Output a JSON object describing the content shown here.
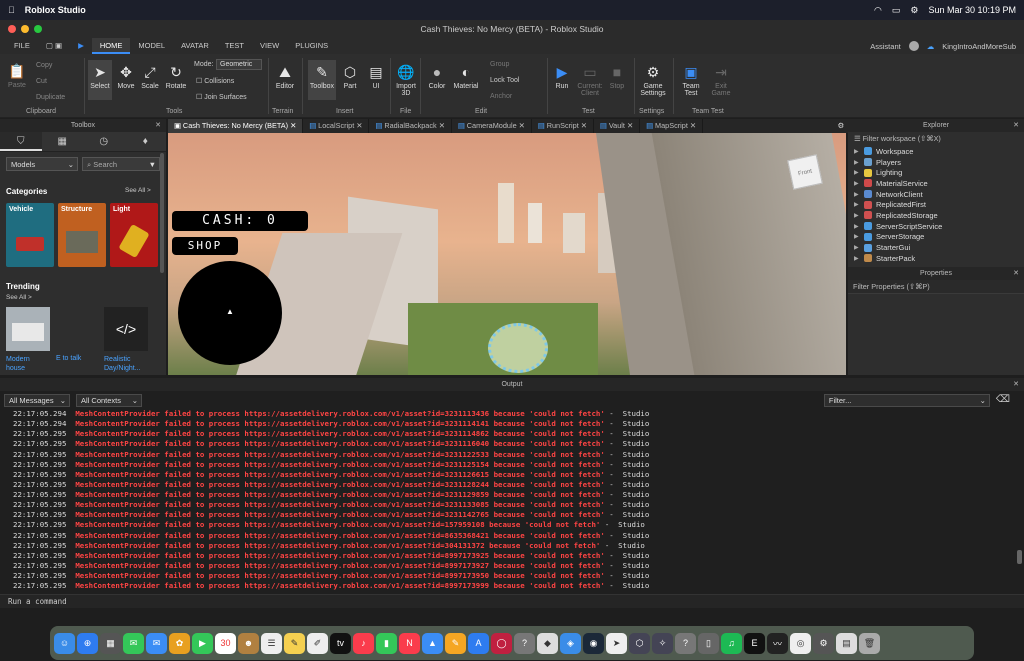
{
  "menubar": {
    "app": "Roblox Studio",
    "datetime": "Sun Mar 30  10:19 PM"
  },
  "window": {
    "title": "Cash Thieves: No Mercy (BETA) - Roblox Studio"
  },
  "tabs": [
    {
      "label": "FILE"
    },
    {
      "label": "HOME"
    },
    {
      "label": "MODEL"
    },
    {
      "label": "AVATAR"
    },
    {
      "label": "TEST"
    },
    {
      "label": "VIEW"
    },
    {
      "label": "PLUGINS"
    }
  ],
  "header": {
    "assistant": "Assistant",
    "username": "KingIntroAndMoreSub"
  },
  "ribbon": {
    "clipboard": {
      "paste": "Paste",
      "copy": "Copy",
      "cut": "Cut",
      "duplicate": "Duplicate",
      "group": "Clipboard"
    },
    "tools": {
      "select": "Select",
      "move": "Move",
      "scale": "Scale",
      "rotate": "Rotate",
      "mode_label": "Mode:",
      "mode_value": "Geometric",
      "collisions": "Collisions",
      "join": "Join Surfaces",
      "group": "Tools"
    },
    "terrain": {
      "editor": "Editor",
      "group": "Terrain"
    },
    "insert": {
      "toolbox": "Toolbox",
      "part": "Part",
      "ui": "UI",
      "group": "Insert"
    },
    "file": {
      "import": "Import",
      "import2": "3D",
      "group": "File"
    },
    "edit": {
      "color": "Color",
      "material": "Material",
      "grp": "Group",
      "lock": "Lock Tool",
      "anchor": "Anchor",
      "group": "Edit"
    },
    "test": {
      "run": "Run",
      "client": "Current:",
      "client2": "Client",
      "stop": "Stop",
      "group": "Test"
    },
    "settings": {
      "game": "Game",
      "game2": "Settings",
      "group": "Settings"
    },
    "teamtest": {
      "team": "Team",
      "team2": "Test",
      "exit": "Exit",
      "exit2": "Game",
      "group": "Team Test"
    }
  },
  "toolbox": {
    "title": "Toolbox",
    "dropdown": "Models",
    "search": "Search",
    "categories": "Categories",
    "see_all": "See All >",
    "cats": [
      "Vehicle",
      "Structure",
      "Light"
    ],
    "trending": "Trending",
    "trend_see_all": "See All >",
    "trend_items": [
      "Modern house",
      "E to talk",
      "Realistic Day/Night..."
    ]
  },
  "doc_tabs": [
    "Cash Thieves: No Mercy (BETA)",
    "LocalScript",
    "RadialBackpack",
    "CameraModule",
    "RunScript",
    "Vault",
    "MapScript"
  ],
  "game_ui": {
    "cash": "CASH: 0",
    "shop": "SHOP",
    "cube": "Front"
  },
  "explorer": {
    "title": "Explorer",
    "filter": "Filter workspace (⇧⌘X)",
    "items": [
      "Workspace",
      "Players",
      "Lighting",
      "MaterialService",
      "NetworkClient",
      "ReplicatedFirst",
      "ReplicatedStorage",
      "ServerScriptService",
      "ServerStorage",
      "StarterGui",
      "StarterPack"
    ]
  },
  "properties": {
    "title": "Properties",
    "filter": "Filter Properties (⇧⌘P)"
  },
  "output": {
    "title": "Output",
    "messages": "All Messages",
    "contexts": "All Contexts",
    "filter": "Filter...",
    "lines": [
      {
        "t": "22:17:05.294",
        "id": "3231113436"
      },
      {
        "t": "22:17:05.294",
        "id": "3231114141"
      },
      {
        "t": "22:17:05.295",
        "id": "3231114862"
      },
      {
        "t": "22:17:05.295",
        "id": "3231116040"
      },
      {
        "t": "22:17:05.295",
        "id": "3231122533"
      },
      {
        "t": "22:17:05.295",
        "id": "3231125154"
      },
      {
        "t": "22:17:05.295",
        "id": "3231126615"
      },
      {
        "t": "22:17:05.295",
        "id": "3231128244"
      },
      {
        "t": "22:17:05.295",
        "id": "3231129859"
      },
      {
        "t": "22:17:05.295",
        "id": "3231133085"
      },
      {
        "t": "22:17:05.295",
        "id": "3231142765"
      },
      {
        "t": "22:17:05.295",
        "id": "157959108"
      },
      {
        "t": "22:17:05.295",
        "id": "8635368421"
      },
      {
        "t": "22:17:05.295",
        "id": "304131372"
      },
      {
        "t": "22:17:05.295",
        "id": "8997173925"
      },
      {
        "t": "22:17:05.295",
        "id": "8997173927"
      },
      {
        "t": "22:17:05.295",
        "id": "8997173950"
      },
      {
        "t": "22:17:05.295",
        "id": "8997173999"
      }
    ],
    "msg_prefix": "MeshContentProvider failed to process https://assetdelivery.roblox.com/v1/asset?id=",
    "msg_suffix": " because 'could not fetch'",
    "source": " -  Studio"
  },
  "command": {
    "placeholder": "Run a command"
  },
  "colors": {
    "accent": "#3b8df5",
    "error": "#ff4444"
  }
}
